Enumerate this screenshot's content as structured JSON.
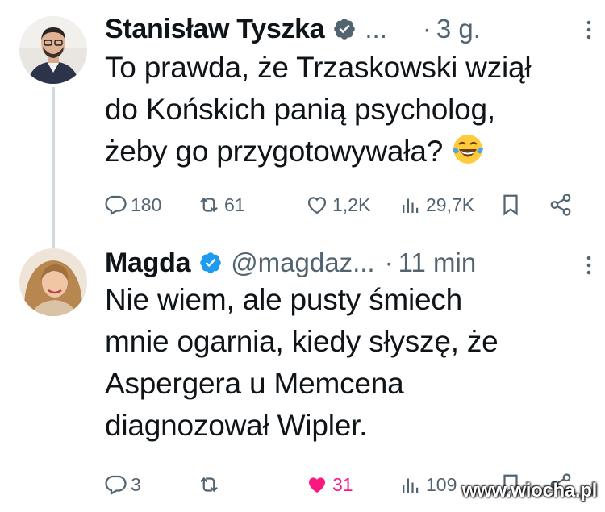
{
  "tweets": [
    {
      "name": "Stanisław Tyszka",
      "verified": true,
      "handle": "...",
      "separator": "·",
      "time": "3 g.",
      "text_lines": [
        "To prawda, że Trzaskowski wziął",
        "do Końskich panią psycholog,",
        "żeby go przygotowywała?"
      ],
      "emoji": "face-with-tears-of-joy",
      "actions": {
        "replies": "180",
        "reposts": "61",
        "likes": "1,2K",
        "views": "29,7K"
      }
    },
    {
      "name": "Magda",
      "verified": true,
      "handle": "@magdaz...",
      "separator": "·",
      "time": "11 min",
      "text_lines": [
        "Nie wiem, ale pusty śmiech",
        "mnie ogarnia, kiedy słyszę, że",
        "Aspergera u Memcena",
        "diagnozował Wipler."
      ],
      "actions": {
        "replies": "3",
        "reposts": "",
        "likes": "31",
        "views": "109"
      },
      "liked": true
    }
  ],
  "watermark": "www.wiocha.pl",
  "colors": {
    "verified": "#1d9bf0",
    "secondary_text": "#536471",
    "like_active": "#f91880",
    "thread_line": "#cfd9de"
  }
}
